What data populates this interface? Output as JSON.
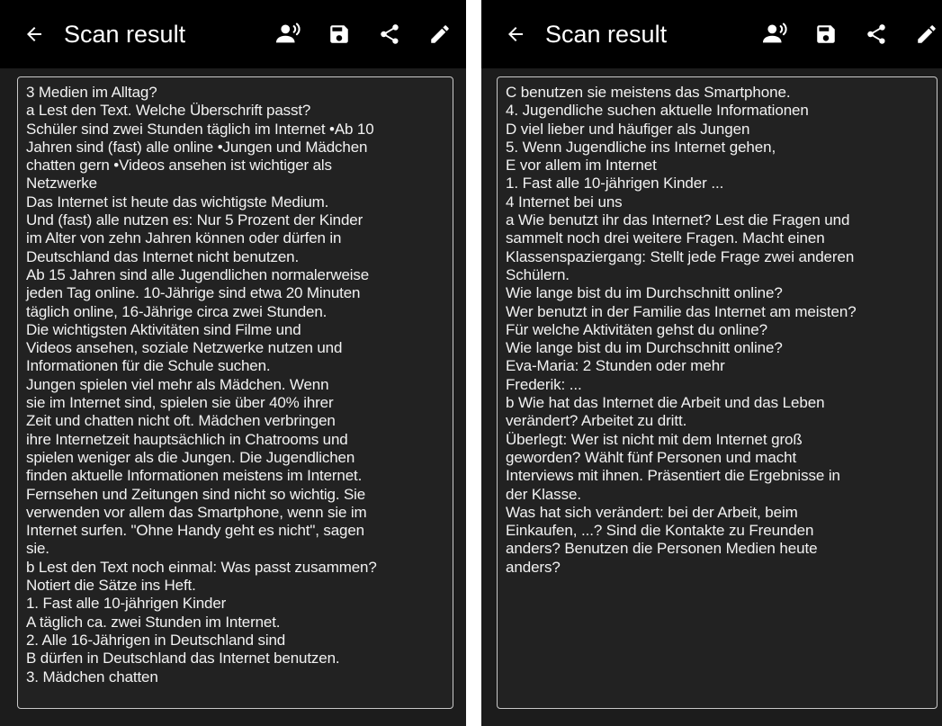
{
  "screens": [
    {
      "appbar": {
        "title": "Scan result",
        "icons": [
          "back-arrow-icon",
          "speak-icon",
          "save-icon",
          "share-icon",
          "edit-icon"
        ]
      },
      "lines": [
        "3 Medien im Alltag?",
        "a Lest den Text. Welche Überschrift passt?",
        "Schüler sind zwei Stunden täglich im Internet •Ab 10",
        "Jahren sind (fast) alle online •Jungen und Mädchen",
        "chatten gern •Videos ansehen ist wichtiger als",
        "Netzwerke",
        "Das Internet ist heute das wichtigste Medium.",
        "Und (fast) alle nutzen es: Nur 5 Prozent der Kinder",
        "im Alter von zehn Jahren können oder dürfen in",
        "Deutschland das Internet nicht benutzen.",
        "Ab 15 Jahren sind alle Jugendlichen normalerweise",
        "jeden Tag online. 10-Jährige sind etwa 20 Minuten",
        "täglich online, 16-Jährige circa zwei Stunden.",
        "Die wichtigsten Aktivitäten sind Filme und",
        "Videos ansehen, soziale Netzwerke nutzen und",
        "Informationen für die Schule suchen.",
        "Jungen spielen viel mehr als Mädchen. Wenn",
        "sie im Internet sind, spielen sie über 40% ihrer",
        "Zeit und chatten nicht oft. Mädchen verbringen",
        "ihre Internetzeit hauptsächlich in Chatrooms und",
        "spielen weniger als die Jungen. Die Jugendlichen",
        "finden aktuelle Informationen meistens im Internet.",
        "Fernsehen und Zeitungen sind nicht so wichtig. Sie",
        "verwenden vor allem das Smartphone, wenn sie im",
        "Internet surfen. \"Ohne Handy geht es nicht\", sagen",
        "sie.",
        "b Lest den Text noch einmal: Was passt zusammen?",
        "Notiert die Sätze ins Heft.",
        "1. Fast alle 10-jährigen Kinder",
        "A täglich ca. zwei Stunden im Internet.",
        "2. Alle 16-Jährigen in Deutschland sind",
        "B dürfen in Deutschland das Internet benutzen.",
        "3. Mädchen chatten"
      ]
    },
    {
      "appbar": {
        "title": "Scan result",
        "icons": [
          "back-arrow-icon",
          "speak-icon",
          "save-icon",
          "share-icon",
          "edit-icon"
        ]
      },
      "lines": [
        "C benutzen sie meistens das Smartphone.",
        "4. Jugendliche suchen aktuelle Informationen",
        "D viel lieber und häufiger als Jungen",
        "5. Wenn Jugendliche ins Internet gehen,",
        "E vor allem im Internet",
        "1. Fast alle 10-jährigen Kinder ...",
        "4 Internet bei uns",
        "a Wie benutzt ihr das Internet? Lest die Fragen und",
        "sammelt noch drei weitere Fragen. Macht einen",
        "Klassenspaziergang: Stellt jede Frage zwei anderen",
        "Schülern.",
        "Wie lange bist du im Durchschnitt online?",
        "Wer benutzt in der Familie das Internet am meisten?",
        "Für welche Aktivitäten gehst du online?",
        "Wie lange bist du im Durchschnitt online?",
        "Eva-Maria: 2 Stunden oder mehr",
        "Frederik: ...",
        "b Wie hat das Internet die Arbeit und das Leben",
        "verändert? Arbeitet zu dritt.",
        "Überlegt: Wer ist nicht mit dem Internet groß",
        "geworden? Wählt fünf Personen und macht",
        "Interviews mit ihnen. Präsentiert die Ergebnisse in",
        "der Klasse.",
        "Was hat sich verändert: bei der Arbeit, beim",
        "Einkaufen, ...? Sind die Kontakte zu Freunden",
        "anders? Benutzen die Personen Medien heute",
        "anders?"
      ]
    }
  ],
  "colors": {
    "appbar": "#000000",
    "background": "#1c1c1c",
    "text": "#f2f2f2",
    "border": "#c9c9c9"
  }
}
